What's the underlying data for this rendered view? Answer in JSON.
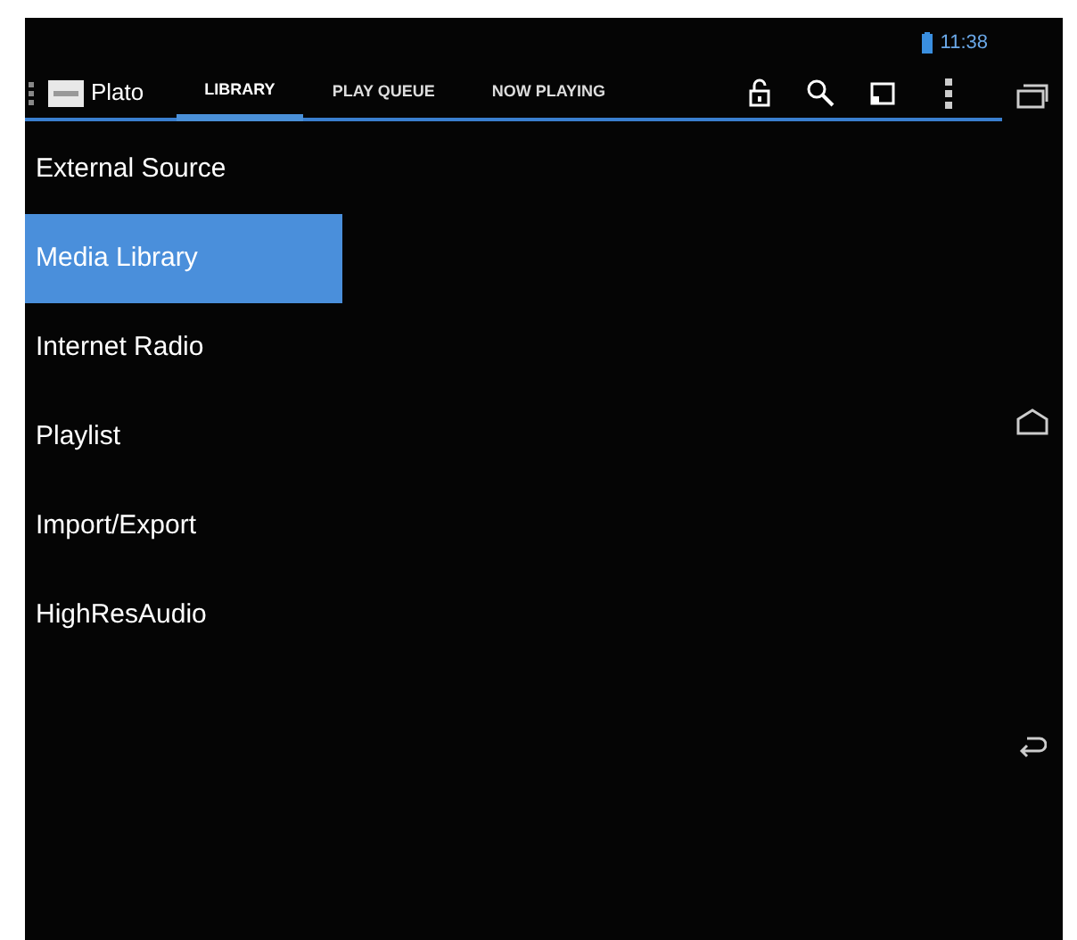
{
  "status_bar": {
    "time": "11:38"
  },
  "action_bar": {
    "app_name": "Plato",
    "tabs": [
      {
        "label": "LIBRARY",
        "selected": true
      },
      {
        "label": "PLAY QUEUE",
        "selected": false
      },
      {
        "label": "NOW PLAYING",
        "selected": false
      }
    ]
  },
  "menu": [
    {
      "label": "External Source",
      "selected": false
    },
    {
      "label": "Media Library",
      "selected": true
    },
    {
      "label": "Internet Radio",
      "selected": false
    },
    {
      "label": "Playlist",
      "selected": false
    },
    {
      "label": "Import/Export",
      "selected": false
    },
    {
      "label": "HighResAudio",
      "selected": false
    }
  ]
}
